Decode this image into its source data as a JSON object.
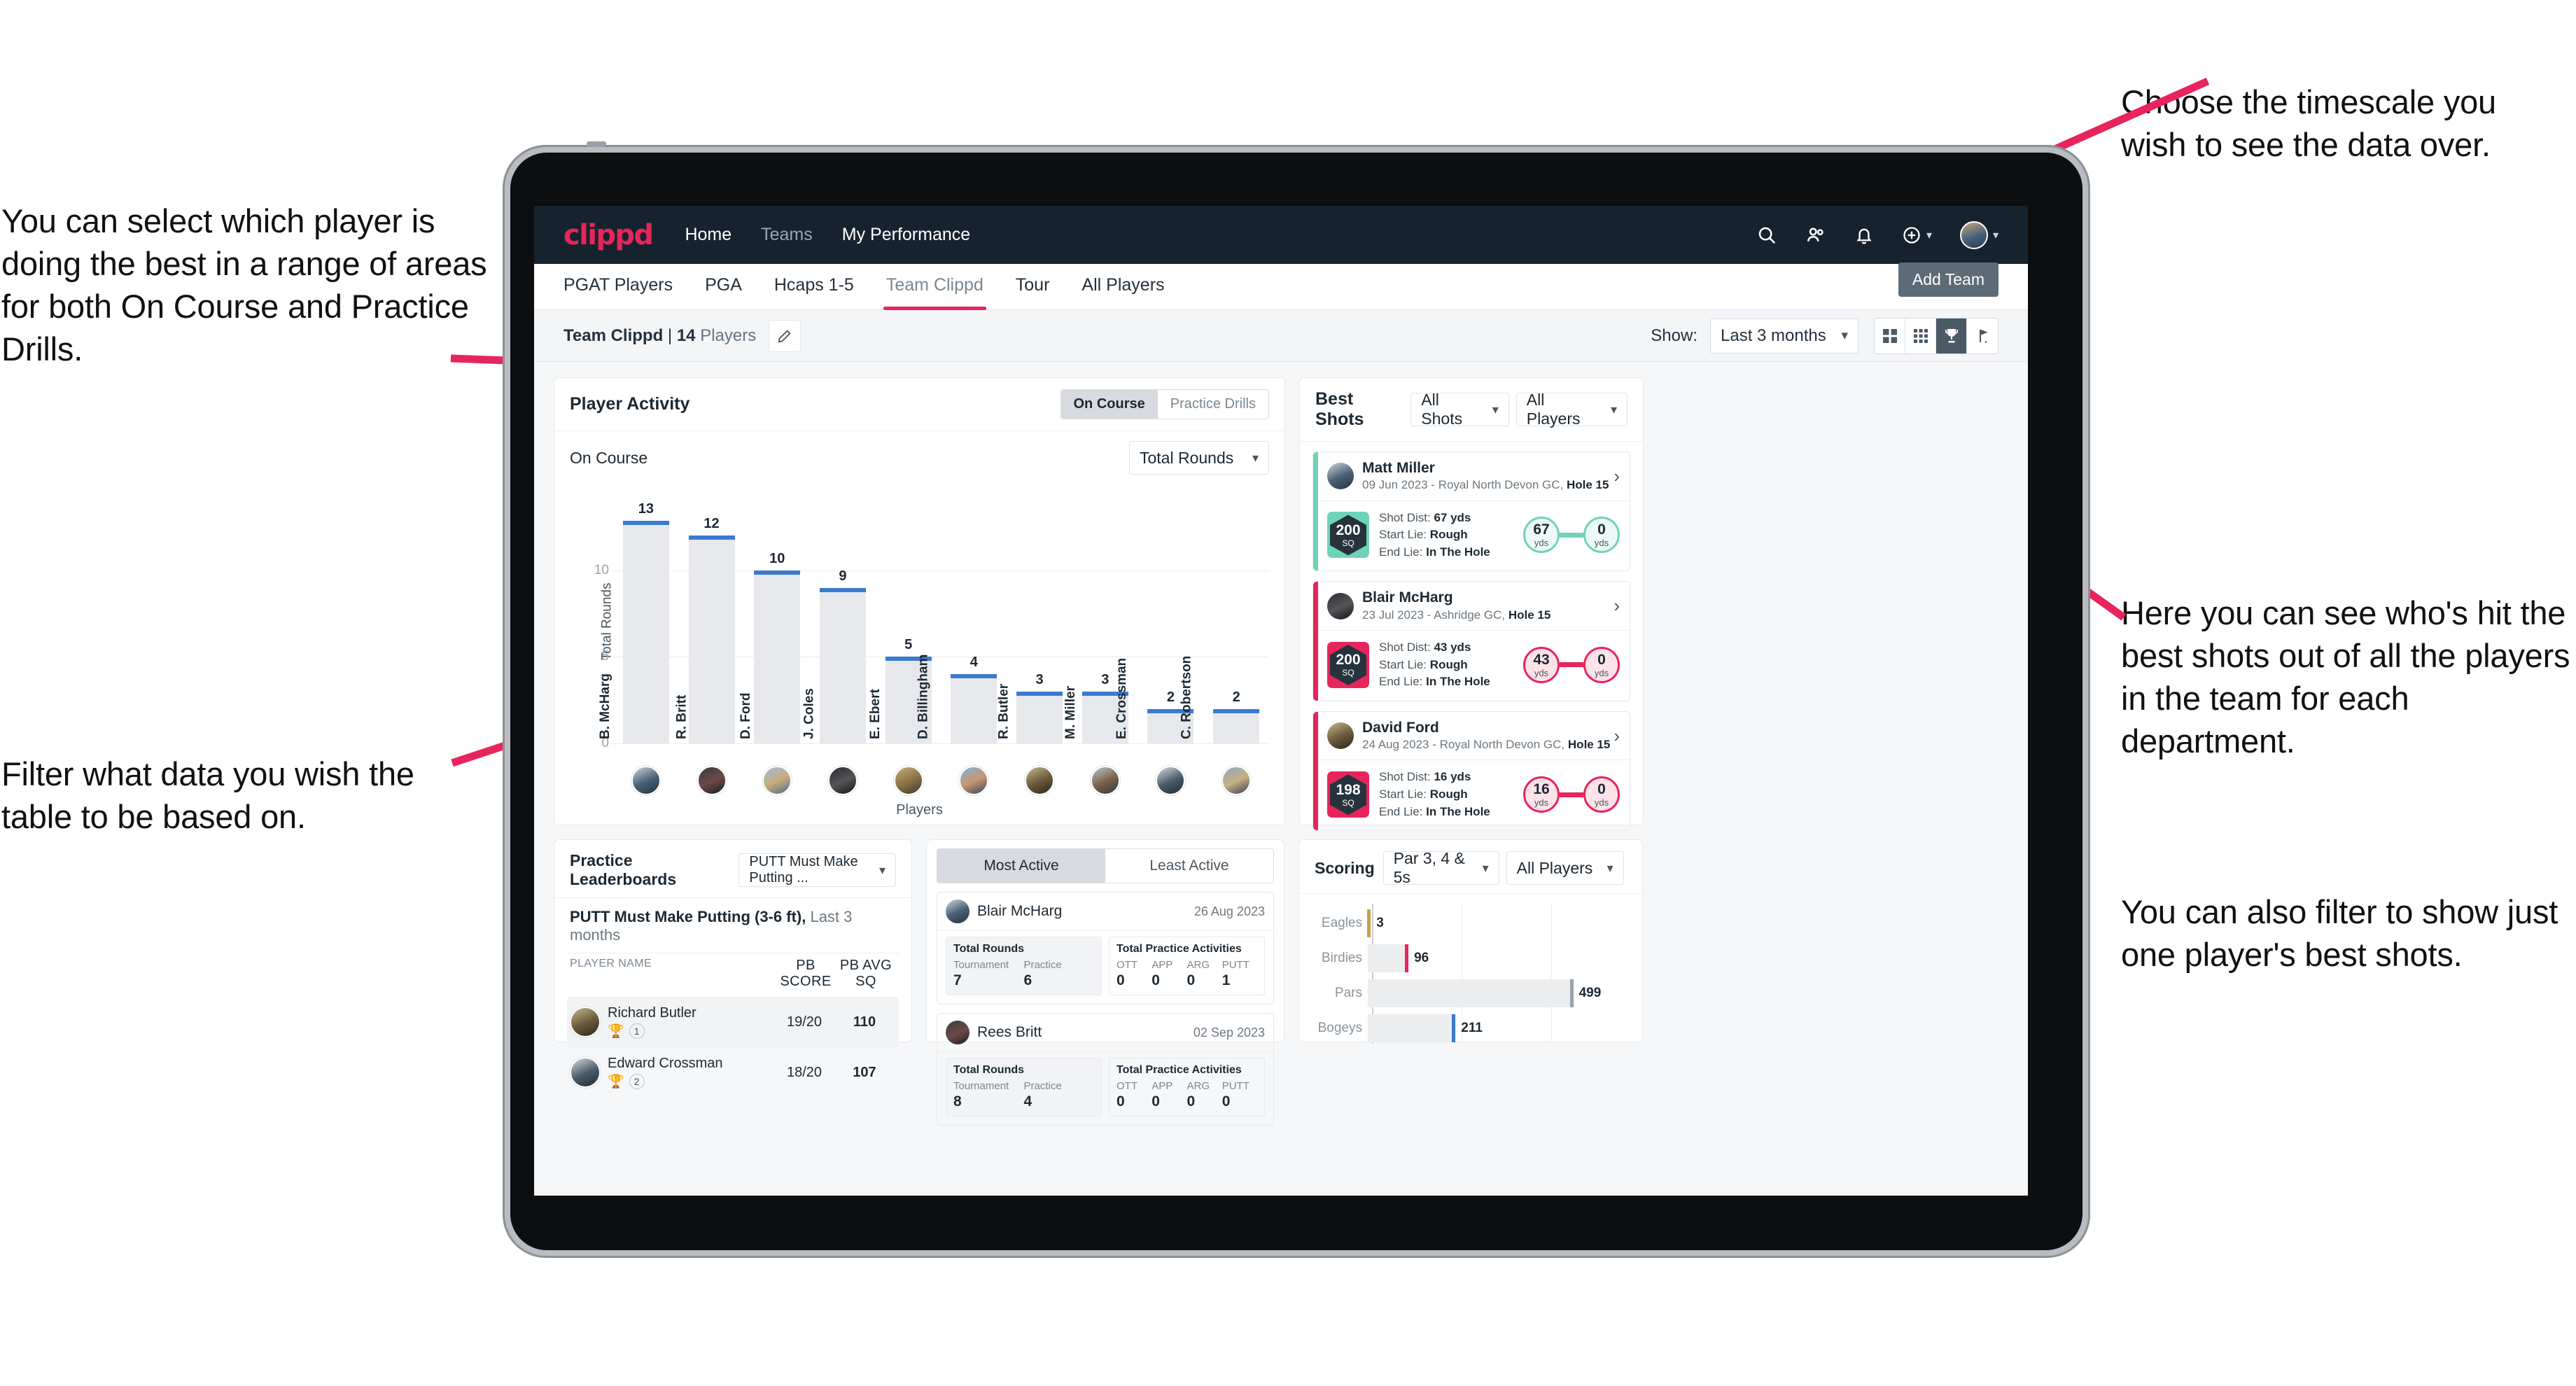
{
  "annotations": {
    "left_top": "You can select which player is doing the best in a range of areas for both On Course and Practice Drills.",
    "left_bottom": "Filter what data you wish the table to be based on.",
    "right_top": "Choose the timescale you wish to see the data over.",
    "right_middle": "Here you can see who's hit the best shots out of all the players in the team for each department.",
    "right_bottom": "You can also filter to show just one player's best shots."
  },
  "navbar": {
    "brand": "clippd",
    "links": [
      {
        "label": "Home",
        "dim": false
      },
      {
        "label": "Teams",
        "dim": true
      },
      {
        "label": "My Performance",
        "dim": false
      }
    ],
    "icons": [
      "search-icon",
      "people-icon",
      "bell-icon",
      "plus-circle-icon",
      "avatar"
    ]
  },
  "tabs": [
    {
      "label": "PGAT Players",
      "active": false
    },
    {
      "label": "PGA",
      "active": false
    },
    {
      "label": "Hcaps 1-5",
      "active": false
    },
    {
      "label": "Team Clippd",
      "active": true
    },
    {
      "label": "Tour",
      "active": false
    },
    {
      "label": "All Players",
      "active": false
    }
  ],
  "tooltip": {
    "add_team": "Add Team"
  },
  "subbar": {
    "team_name": "Team Clippd",
    "separator": "|",
    "player_count": "14",
    "players_word": "Players",
    "edit_icon": "pencil-icon",
    "show_label": "Show:",
    "timescale_value": "Last 3 months",
    "view_toggles": [
      {
        "icon": "grid-2x2-icon",
        "active": false
      },
      {
        "icon": "grid-3x3-icon",
        "active": false
      },
      {
        "icon": "trophy-icon",
        "active": true
      },
      {
        "icon": "golf-flag-icon",
        "active": false
      }
    ]
  },
  "player_activity": {
    "title": "Player Activity",
    "segments": [
      {
        "label": "On Course",
        "active": true
      },
      {
        "label": "Practice Drills",
        "active": false
      }
    ],
    "sub_label": "On Course",
    "metric_select": "Total Rounds"
  },
  "chart_data": [
    {
      "type": "bar",
      "title": "Player Activity",
      "xlabel": "Players",
      "ylabel": "Total Rounds",
      "categories": [
        "B. McHarg",
        "R. Britt",
        "D. Ford",
        "J. Coles",
        "E. Ebert",
        "D. Billingham",
        "R. Butler",
        "M. Miller",
        "E. Crossman",
        "C. Robertson"
      ],
      "values": [
        13,
        12,
        10,
        9,
        5,
        4,
        3,
        3,
        2,
        2
      ],
      "ylim": [
        0,
        14
      ],
      "yticks": [
        0,
        5,
        10
      ],
      "grid": true,
      "bar_color": "#e6e8eb",
      "cap_color": "#3a7ad0"
    },
    {
      "type": "bar",
      "orientation": "horizontal",
      "title": "Scoring",
      "categories": [
        "Eagles",
        "Birdies",
        "Pars",
        "Bogeys"
      ],
      "values": [
        3,
        96,
        499,
        211
      ],
      "xlim": [
        0,
        640
      ],
      "grid": true,
      "cap_colors": [
        "#c9a24a",
        "#e8245c",
        "#9aa3ab",
        "#3a7ad0"
      ]
    }
  ],
  "best_shots": {
    "title": "Best Shots",
    "filter_shots": "All Shots",
    "filter_players": "All Players",
    "cards": [
      {
        "player": "Matt Miller",
        "meta_prefix": "09 Jun 2023 - Royal North Devon GC,",
        "hole": "Hole 15",
        "sq_value": "200",
        "sq_unit": "SQ",
        "accent": "#6fd3b8",
        "shot_dist_label": "Shot Dist:",
        "shot_dist": "67 yds",
        "start_lie_label": "Start Lie:",
        "start_lie": "Rough",
        "end_lie_label": "End Lie:",
        "end_lie": "In The Hole",
        "from_value": "67",
        "from_unit": "yds",
        "to_value": "0",
        "to_unit": "yds"
      },
      {
        "player": "Blair McHarg",
        "meta_prefix": "23 Jul 2023 - Ashridge GC,",
        "hole": "Hole 15",
        "sq_value": "200",
        "sq_unit": "SQ",
        "accent": "#e8245c",
        "shot_dist_label": "Shot Dist:",
        "shot_dist": "43 yds",
        "start_lie_label": "Start Lie:",
        "start_lie": "Rough",
        "end_lie_label": "End Lie:",
        "end_lie": "In The Hole",
        "from_value": "43",
        "from_unit": "yds",
        "to_value": "0",
        "to_unit": "yds"
      },
      {
        "player": "David Ford",
        "meta_prefix": "24 Aug 2023 - Royal North Devon GC,",
        "hole": "Hole 15",
        "sq_value": "198",
        "sq_unit": "SQ",
        "accent": "#e8245c",
        "shot_dist_label": "Shot Dist:",
        "shot_dist": "16 yds",
        "start_lie_label": "Start Lie:",
        "start_lie": "Rough",
        "end_lie_label": "End Lie:",
        "end_lie": "In The Hole",
        "from_value": "16",
        "from_unit": "yds",
        "to_value": "0",
        "to_unit": "yds"
      }
    ]
  },
  "practice_leaderboards": {
    "title": "Practice Leaderboards",
    "drill_select": "PUTT Must Make Putting ...",
    "subtitle_bold": "PUTT Must Make Putting (3-6 ft),",
    "subtitle_light": "Last 3 months",
    "columns": [
      "PLAYER NAME",
      "PB SCORE",
      "PB AVG SQ"
    ],
    "rows": [
      {
        "name": "Richard Butler",
        "rank": "1",
        "trophy": "gold",
        "pb_score": "19/20",
        "pb_avg_sq": "110",
        "highlight": true
      },
      {
        "name": "Edward Crossman",
        "rank": "2",
        "trophy": "silver",
        "pb_score": "18/20",
        "pb_avg_sq": "107",
        "highlight": false
      }
    ]
  },
  "activity": {
    "tabs": [
      {
        "label": "Most Active",
        "active": true
      },
      {
        "label": "Least Active",
        "active": false
      }
    ],
    "cards": [
      {
        "player": "Blair McHarg",
        "date": "26 Aug 2023",
        "rounds_title": "Total Rounds",
        "rounds": [
          {
            "key": "Tournament",
            "value": "7"
          },
          {
            "key": "Practice",
            "value": "6"
          }
        ],
        "practice_title": "Total Practice Activities",
        "practice": [
          {
            "key": "OTT",
            "value": "0"
          },
          {
            "key": "APP",
            "value": "0"
          },
          {
            "key": "ARG",
            "value": "0"
          },
          {
            "key": "PUTT",
            "value": "1"
          }
        ]
      },
      {
        "player": "Rees Britt",
        "date": "02 Sep 2023",
        "rounds_title": "Total Rounds",
        "rounds": [
          {
            "key": "Tournament",
            "value": "8"
          },
          {
            "key": "Practice",
            "value": "4"
          }
        ],
        "practice_title": "Total Practice Activities",
        "practice": [
          {
            "key": "OTT",
            "value": "0"
          },
          {
            "key": "APP",
            "value": "0"
          },
          {
            "key": "ARG",
            "value": "0"
          },
          {
            "key": "PUTT",
            "value": "0"
          }
        ]
      }
    ]
  },
  "scoring": {
    "title": "Scoring",
    "filter_par": "Par 3, 4 & 5s",
    "filter_players": "All Players"
  },
  "colors": {
    "brand_pink": "#e8245c",
    "nav_navy": "#16232f",
    "bar_blue": "#3a7ad0",
    "teal": "#6fd3b8",
    "gold": "#c9a24a"
  }
}
